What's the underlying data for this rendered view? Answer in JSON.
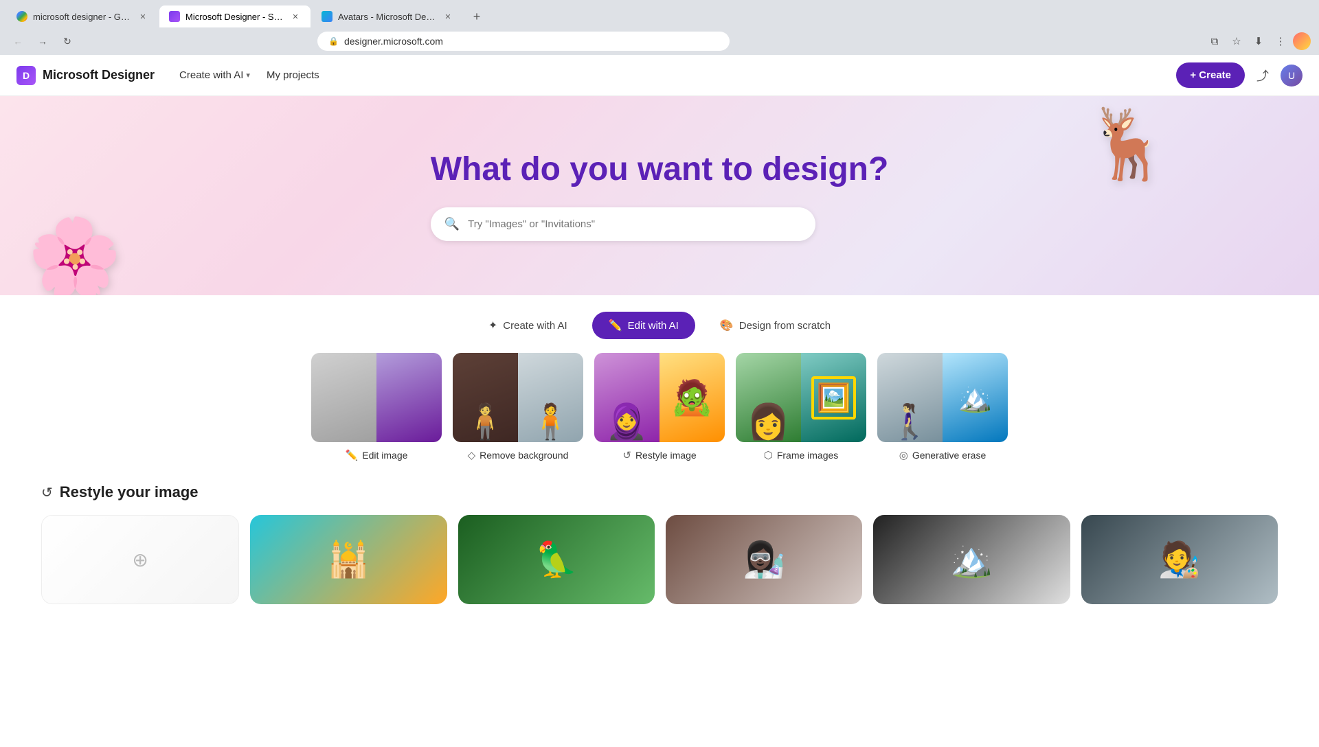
{
  "browser": {
    "tabs": [
      {
        "id": "tab1",
        "label": "microsoft designer - Google S...",
        "favicon": "google",
        "active": false
      },
      {
        "id": "tab2",
        "label": "Microsoft Designer - Stunning ...",
        "favicon": "designer",
        "active": true
      },
      {
        "id": "tab3",
        "label": "Avatars - Microsoft Designer",
        "favicon": "avatars",
        "active": false
      }
    ],
    "new_tab_label": "+",
    "address": "designer.microsoft.com"
  },
  "nav": {
    "logo_text": "Microsoft Designer",
    "create_with_ai_label": "Create with AI",
    "my_projects_label": "My projects",
    "create_button_label": "+ Create"
  },
  "hero": {
    "title": "What do you want to design?",
    "search_placeholder": "Try \"Images\" or \"Invitations\""
  },
  "tabs": [
    {
      "id": "create_ai",
      "label": "Create with AI",
      "icon": "✦",
      "active": false
    },
    {
      "id": "edit_ai",
      "label": "Edit with AI",
      "icon": "✏️",
      "active": true
    },
    {
      "id": "design_scratch",
      "label": "Design from scratch",
      "icon": "🎨",
      "active": false
    }
  ],
  "image_cards": [
    {
      "id": "edit_image",
      "label": "Edit image",
      "icon": "✏️"
    },
    {
      "id": "remove_bg",
      "label": "Remove background",
      "icon": "◇"
    },
    {
      "id": "restyle_image",
      "label": "Restyle image",
      "icon": "↺"
    },
    {
      "id": "frame_images",
      "label": "Frame images",
      "icon": "⬡"
    },
    {
      "id": "generative_erase",
      "label": "Generative erase",
      "icon": "◎"
    }
  ],
  "restyle_section": {
    "title": "Restyle your image",
    "icon": "↺"
  }
}
